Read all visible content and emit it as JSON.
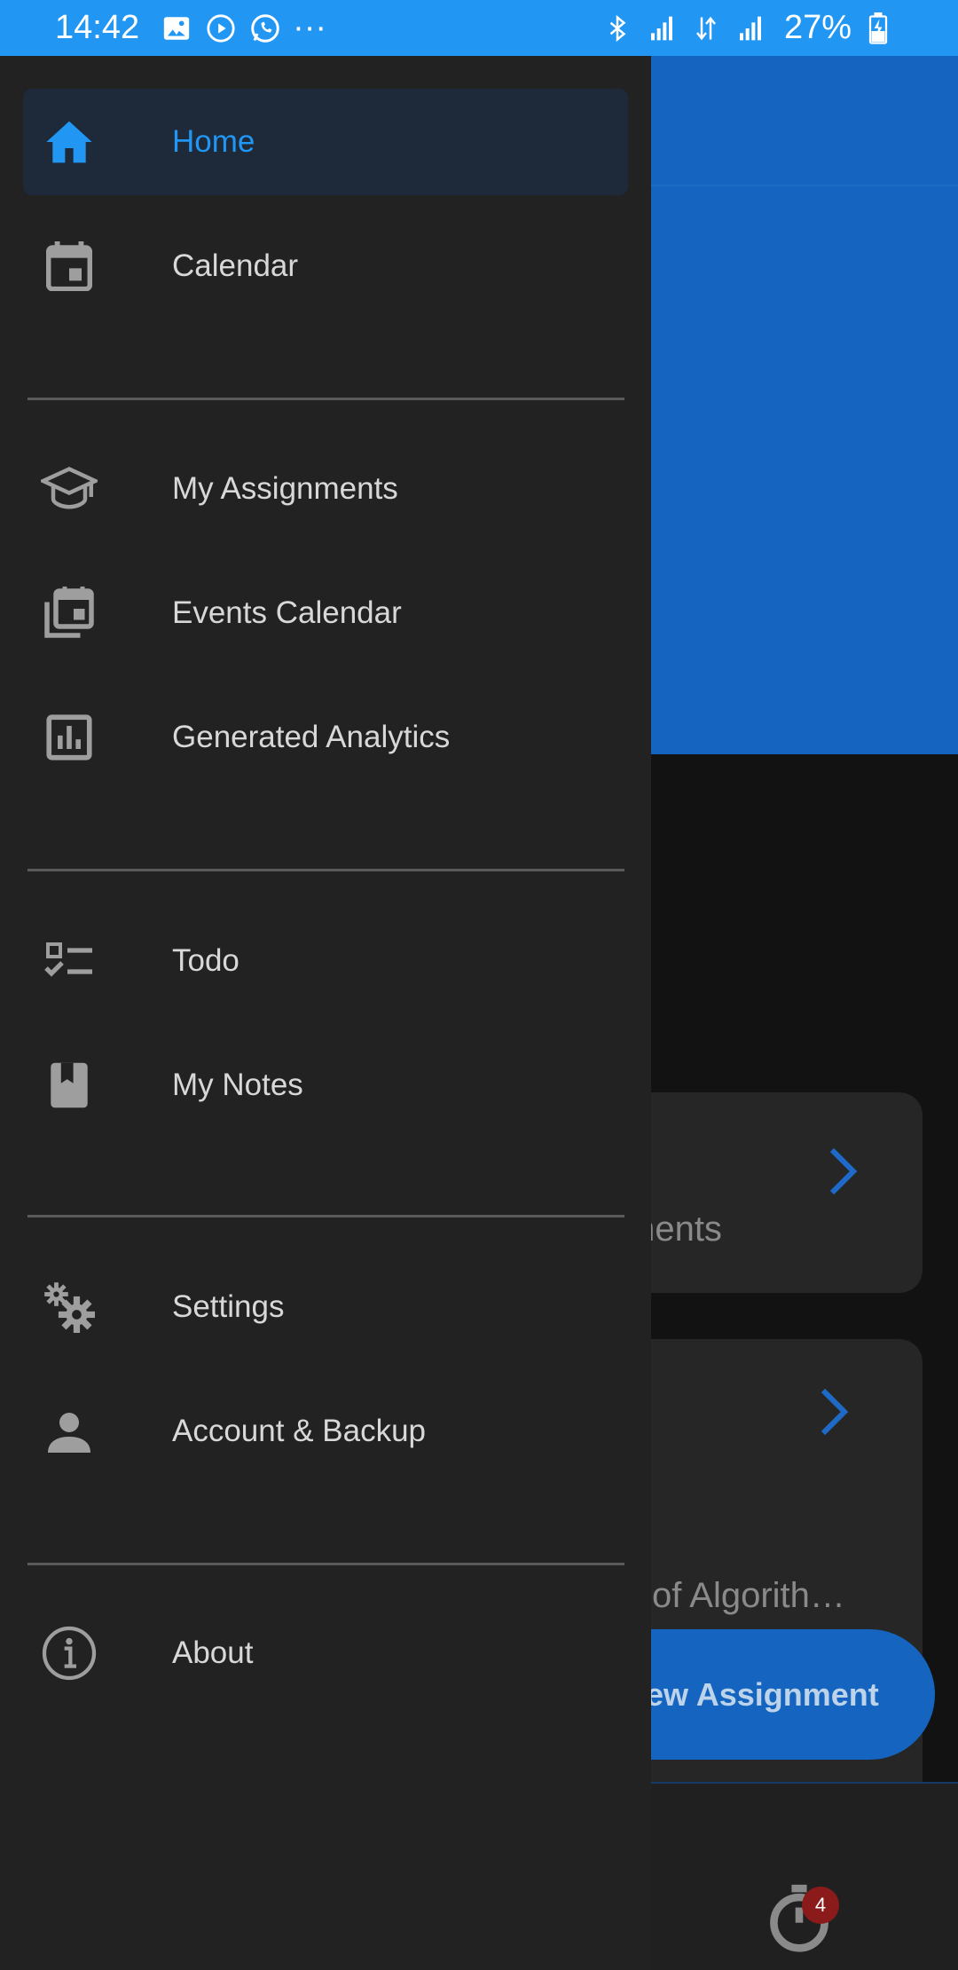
{
  "status_bar": {
    "time": "14:42",
    "more": "···",
    "battery": "27%"
  },
  "background": {
    "title_fragment": "nents",
    "card1_text": "ments",
    "card2_text": "is of Algorith…",
    "fab_label": "ew Assignment",
    "timer_badge": "4"
  },
  "drawer": {
    "items": [
      {
        "label": "Home",
        "icon": "home-icon"
      },
      {
        "label": "Calendar",
        "icon": "calendar-icon"
      },
      {
        "label": "My Assignments",
        "icon": "graduation-cap-icon"
      },
      {
        "label": "Events Calendar",
        "icon": "events-calendar-icon"
      },
      {
        "label": "Generated Analytics",
        "icon": "analytics-icon"
      },
      {
        "label": "Todo",
        "icon": "checklist-icon"
      },
      {
        "label": "My Notes",
        "icon": "book-icon"
      },
      {
        "label": "Settings",
        "icon": "gears-icon"
      },
      {
        "label": "Account & Backup",
        "icon": "person-icon"
      },
      {
        "label": "About",
        "icon": "info-icon"
      }
    ]
  },
  "colors": {
    "accent": "#2196f3",
    "drawer_bg": "#222222",
    "header_bg": "#1565c0",
    "badge": "#8b1a1a"
  }
}
